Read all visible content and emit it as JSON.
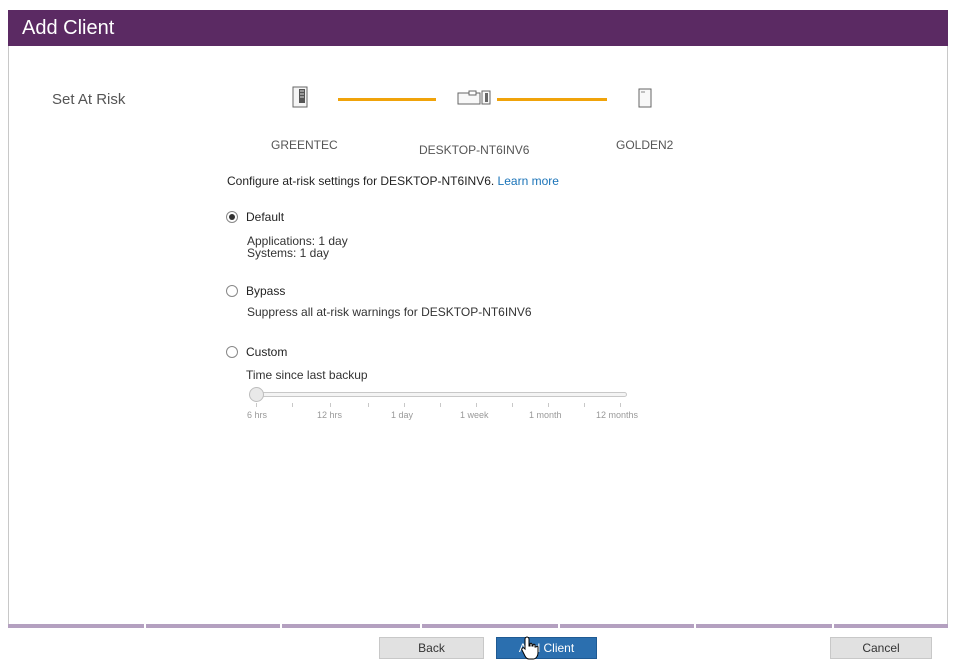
{
  "window": {
    "title": "Add Client"
  },
  "step": {
    "label": "Set At Risk"
  },
  "nodes": [
    {
      "name": "GREENTEC",
      "icon": "server-tower-icon"
    },
    {
      "name": "DESKTOP-NT6INV6",
      "icon": "desktop-computer-icon"
    },
    {
      "name": "GOLDEN2",
      "icon": "nas-drive-icon"
    }
  ],
  "description": {
    "text": "Configure at-risk settings for DESKTOP-NT6INV6.",
    "link": "Learn more"
  },
  "options": {
    "selected": "default",
    "default": {
      "label": "Default",
      "detail_1": "Applications: 1 day",
      "detail_2": "Systems: 1 day"
    },
    "bypass": {
      "label": "Bypass",
      "detail": "Suppress all at-risk warnings for DESKTOP-NT6INV6"
    },
    "custom": {
      "label": "Custom",
      "slider_label": "Time since last backup"
    }
  },
  "slider": {
    "ticks": [
      "6 hrs",
      "12 hrs",
      "1 day",
      "1 week",
      "1 month",
      "12 months"
    ],
    "value": "6 hrs"
  },
  "footer": {
    "back": "Back",
    "add": "Add Client",
    "cancel": "Cancel"
  },
  "colors": {
    "titlebar": "#5b2a63",
    "connector": "#f0a30a",
    "primary_button": "#2b6faf",
    "link": "#1a73b8"
  }
}
